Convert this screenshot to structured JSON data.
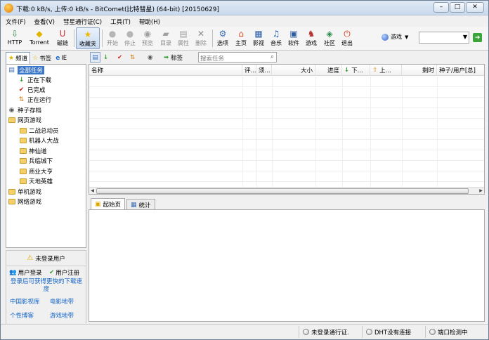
{
  "window": {
    "title": "下载:0 kB/s, 上传:0 kB/s - BitComet(比特彗星) (64-bit) [20150629]",
    "controls": [
      "–",
      "□",
      "✕"
    ]
  },
  "menu": [
    "文件(F)",
    "查看(V)",
    "彗星通行证(C)",
    "工具(T)",
    "帮助(H)"
  ],
  "toolbar": {
    "items": [
      {
        "label": "HTTP",
        "icon": "http-icon",
        "glyph": "⇩",
        "enabled": true
      },
      {
        "label": "Torrent",
        "icon": "torrent-icon",
        "glyph": "◆",
        "enabled": true
      },
      {
        "label": "磁链",
        "icon": "magnet-icon",
        "glyph": "U",
        "enabled": true
      },
      {
        "label": "收藏夹",
        "icon": "favorites-star-icon",
        "glyph": "★",
        "enabled": true,
        "selected": true
      },
      {
        "label": "开始",
        "icon": "start-icon",
        "glyph": "●",
        "enabled": false
      },
      {
        "label": "停止",
        "icon": "stop-icon",
        "glyph": "●",
        "enabled": false
      },
      {
        "label": "预览",
        "icon": "preview-icon",
        "glyph": "◉",
        "enabled": false
      },
      {
        "label": "目录",
        "icon": "folder-open-icon",
        "glyph": "▰",
        "enabled": false
      },
      {
        "label": "属性",
        "icon": "properties-icon",
        "glyph": "▤",
        "enabled": false
      },
      {
        "label": "删除",
        "icon": "delete-icon",
        "glyph": "✕",
        "enabled": false
      },
      {
        "label": "选项",
        "icon": "options-icon",
        "glyph": "⚙",
        "enabled": true
      },
      {
        "label": "主页",
        "icon": "home-icon",
        "glyph": "⌂",
        "enabled": true
      },
      {
        "label": "影视",
        "icon": "video-icon",
        "glyph": "▦",
        "enabled": true
      },
      {
        "label": "音乐",
        "icon": "music-icon",
        "glyph": "♫",
        "enabled": true
      },
      {
        "label": "软件",
        "icon": "software-icon",
        "glyph": "▣",
        "enabled": true
      },
      {
        "label": "游戏",
        "icon": "game-icon",
        "glyph": "♞",
        "enabled": true
      },
      {
        "label": "社区",
        "icon": "community-icon",
        "glyph": "◈",
        "enabled": true
      },
      {
        "label": "退出",
        "icon": "exit-icon",
        "glyph": "⏻",
        "enabled": true
      }
    ],
    "search_category": "游戏",
    "search_value": ""
  },
  "left_tabs": [
    {
      "label": "频道",
      "icon": "star-icon",
      "glyph": "★",
      "active": true
    },
    {
      "label": "书签",
      "icon": "bookmark-icon",
      "glyph": "☆",
      "active": false
    },
    {
      "label": "IE",
      "icon": "ie-icon",
      "glyph": "e",
      "active": false
    }
  ],
  "tree": [
    {
      "label": "全部任务",
      "icon": "all-tasks-icon",
      "glyph": "▤",
      "level": 0,
      "selected": true
    },
    {
      "label": "正在下载",
      "icon": "downloading-icon",
      "glyph": "↓",
      "level": 1
    },
    {
      "label": "已完成",
      "icon": "completed-icon",
      "glyph": "✔",
      "level": 1
    },
    {
      "label": "正在运行",
      "icon": "running-icon",
      "glyph": "⇅",
      "level": 1
    },
    {
      "label": "种子存档",
      "icon": "torrent-archive-icon",
      "glyph": "◉",
      "level": 0
    },
    {
      "label": "网页游戏",
      "icon": "folder-icon",
      "level": 0
    },
    {
      "label": "二战总动员",
      "icon": "folder-icon",
      "level": 1
    },
    {
      "label": "机器人大战",
      "icon": "folder-icon",
      "level": 1
    },
    {
      "label": "神仙道",
      "icon": "folder-icon",
      "level": 1
    },
    {
      "label": "兵临城下",
      "icon": "folder-icon",
      "level": 1
    },
    {
      "label": "商业大亨",
      "icon": "folder-icon",
      "level": 1
    },
    {
      "label": "天地英雄",
      "icon": "folder-icon",
      "level": 1
    },
    {
      "label": "单机游戏",
      "icon": "folder-icon",
      "level": 0
    },
    {
      "label": "网络游戏",
      "icon": "folder-icon",
      "level": 0
    }
  ],
  "login": {
    "status": "未登录用户",
    "login_btn": "用户登录",
    "register_btn": "用户注册",
    "hint": "登录后可获得更快的下载速度",
    "links": [
      "中国影视库",
      "电影地带",
      "个性博客",
      "游戏地带"
    ]
  },
  "task_toolbar": {
    "tag_label": "标签",
    "search_placeholder": "搜索任务"
  },
  "columns": [
    "名称",
    "评...",
    "须...",
    "大小",
    "进度",
    "下...",
    "上...",
    "剩时",
    "种子/用户[总]"
  ],
  "bottom_tabs": [
    {
      "label": "起始页",
      "icon": "start-page-icon",
      "active": true
    },
    {
      "label": "统计",
      "icon": "statistics-icon",
      "active": false
    }
  ],
  "status_bar": {
    "passport": "未登录通行证.",
    "dht": "DHT没有连接",
    "port": "端口检测中"
  }
}
